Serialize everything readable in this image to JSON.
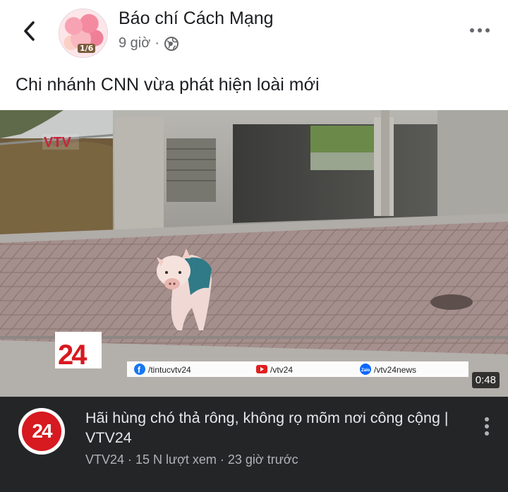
{
  "post": {
    "page_name": "Báo chí Cách Mạng",
    "time": "9 giờ",
    "separator": "·",
    "avatar_badge": "1/6",
    "caption": "Chi nhánh CNN vừa phát hiện loài mới",
    "icons": {
      "back": "chevron-left-icon",
      "audience": "globe-icon",
      "more": "more-horizontal-icon"
    }
  },
  "video": {
    "watermark": "VTV",
    "duration": "0:48",
    "ticker": {
      "logo_text": "24",
      "facebook": "/tintucvtv24",
      "youtube": "/vtv24",
      "zalo": "/vtv24news",
      "zalo_badge": "Zalo"
    }
  },
  "link_preview": {
    "logo_text": "24",
    "title": "Hãi hùng chó thả rông, không rọ mõm nơi công cộng | VTV24",
    "meta": "VTV24 · 15 N lượt xem · 23 giờ trước",
    "more_icon": "more-vertical-icon"
  },
  "colors": {
    "link_bg": "#242526",
    "vtv24_red": "#d71920",
    "meta_gray": "#65676b"
  }
}
